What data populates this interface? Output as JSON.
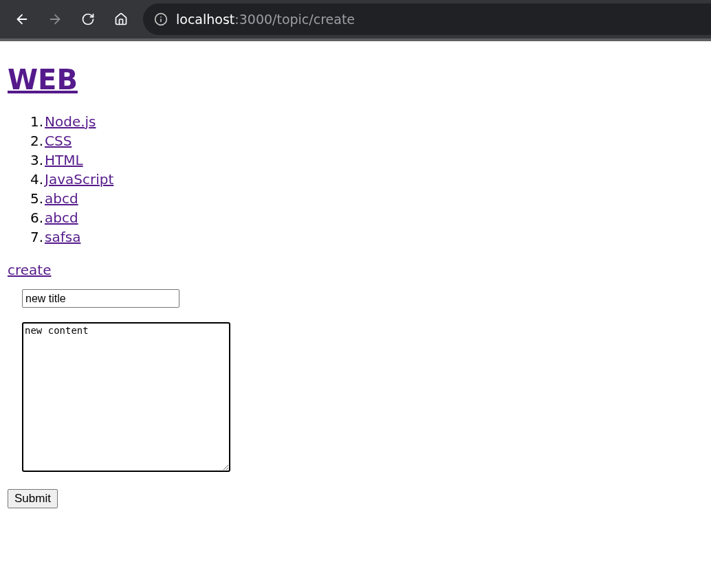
{
  "browser": {
    "back_disabled": false,
    "forward_disabled": true,
    "url_host": "localhost",
    "url_path": ":3000/topic/create"
  },
  "heading": "WEB",
  "topics": [
    {
      "number": "1.",
      "title": "Node.js"
    },
    {
      "number": "2.",
      "title": "CSS"
    },
    {
      "number": "3.",
      "title": "HTML"
    },
    {
      "number": "4.",
      "title": "JavaScript"
    },
    {
      "number": "5.",
      "title": "abcd"
    },
    {
      "number": "6.",
      "title": "abcd"
    },
    {
      "number": "7.",
      "title": "safsa"
    }
  ],
  "create_link": "create",
  "form": {
    "title_value": "new title",
    "content_value": "new content",
    "submit": "Submit"
  }
}
